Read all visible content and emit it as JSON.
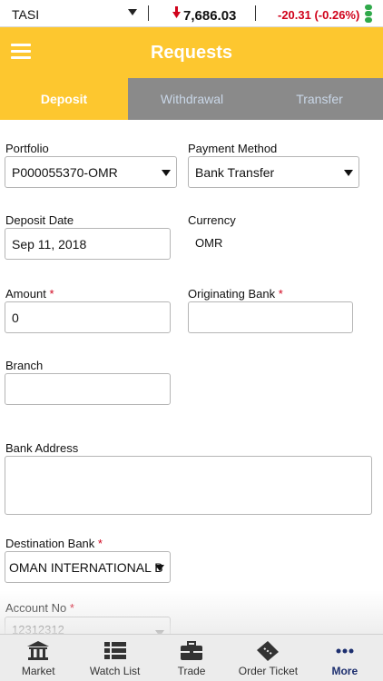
{
  "ticker": {
    "symbol": "TASI",
    "index_value": "7,686.03",
    "change": "-20.31 (-0.26%)",
    "down_color": "#d0021b",
    "status_color": "#2fa94a"
  },
  "header": {
    "title": "Requests",
    "accent_color": "#fdc72f"
  },
  "tabs": [
    {
      "label": "Deposit",
      "active": true
    },
    {
      "label": "Withdrawal",
      "active": false
    },
    {
      "label": "Transfer",
      "active": false
    }
  ],
  "form": {
    "portfolio": {
      "label": "Portfolio",
      "value": "P000055370-OMR"
    },
    "payment_method": {
      "label": "Payment Method",
      "value": "Bank Transfer"
    },
    "deposit_date": {
      "label": "Deposit Date",
      "value": "Sep 11, 2018"
    },
    "currency": {
      "label": "Currency",
      "value": "OMR"
    },
    "amount": {
      "label": "Amount",
      "required_mark": "*",
      "value": "0"
    },
    "originating_bank": {
      "label": "Originating Bank",
      "required_mark": "*",
      "value": ""
    },
    "branch": {
      "label": "Branch",
      "value": ""
    },
    "bank_address": {
      "label": "Bank Address",
      "value": ""
    },
    "destination_bank": {
      "label": "Destination Bank",
      "required_mark": "*",
      "value": "OMAN INTERNATIONAL B"
    },
    "account_no": {
      "label": "Account No",
      "required_mark": "*",
      "value": "12312312"
    }
  },
  "bottom_nav": [
    {
      "label": "Market",
      "icon": "bank-icon"
    },
    {
      "label": "Watch List",
      "icon": "list-icon"
    },
    {
      "label": "Trade",
      "icon": "briefcase-icon"
    },
    {
      "label": "Order Ticket",
      "icon": "ticket-icon"
    },
    {
      "label": "More",
      "icon": "more-icon",
      "active": true
    }
  ]
}
